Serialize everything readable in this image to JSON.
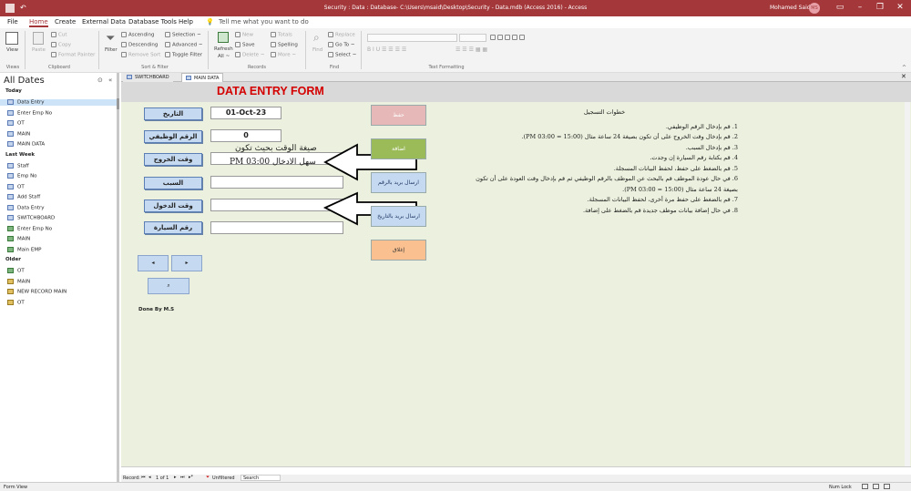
{
  "titlebar": {
    "title": "Security : Data : Database- C:\\Users\\msaid\\Desktop\\Security - Data.mdb (Access 2016) - Access",
    "user": "Mohamed Said",
    "initials": "MS"
  },
  "menu": [
    "File",
    "Home",
    "Create",
    "External Data",
    "Database Tools",
    "Help"
  ],
  "tell_me": "Tell me what you want to do",
  "ribbon": {
    "view": "View",
    "paste": "Paste",
    "cut": "Cut",
    "copy": "Copy",
    "format_painter": "Format Painter",
    "filter": "Filter",
    "ascending": "Ascending",
    "descending": "Descending",
    "remove_sort": "Remove Sort",
    "selection": "Selection ~",
    "advanced": "Advanced ~",
    "toggle_filter": "Toggle Filter",
    "refresh": "Refresh",
    "refresh_all": "All ~",
    "new": "New",
    "save": "Save",
    "delete": "Delete ~",
    "totals": "Totals",
    "spelling": "Spelling",
    "more": "More ~",
    "find": "Find",
    "replace": "Replace",
    "goto": "Go To ~",
    "select": "Select ~",
    "groups": [
      "Views",
      "Clipboard",
      "Sort & Filter",
      "Records",
      "Find",
      "Text Formatting"
    ]
  },
  "nav": {
    "header": "All Dates",
    "sections": [
      {
        "title": "Today",
        "items": [
          {
            "label": "Data Entry",
            "type": "frm",
            "selected": true
          },
          {
            "label": "Enter Emp No",
            "type": "frm"
          },
          {
            "label": "OT",
            "type": "frm"
          },
          {
            "label": "MAIN",
            "type": "frm"
          },
          {
            "label": "MAIN DATA",
            "type": "frm"
          }
        ]
      },
      {
        "title": "Last Week",
        "items": [
          {
            "label": "Staff",
            "type": "frm"
          },
          {
            "label": "Emp No",
            "type": "frm"
          },
          {
            "label": "OT",
            "type": "frm"
          },
          {
            "label": "Add Staff",
            "type": "frm"
          },
          {
            "label": "Data Entry",
            "type": "frm"
          },
          {
            "label": "SWITCHBOARD",
            "type": "frm"
          },
          {
            "label": "Enter Emp No",
            "type": "tbl"
          },
          {
            "label": "MAIN",
            "type": "tbl"
          },
          {
            "label": "Main EMP",
            "type": "tbl"
          }
        ]
      },
      {
        "title": "Older",
        "items": [
          {
            "label": "OT",
            "type": "tbl"
          },
          {
            "label": "MAIN",
            "type": "qry"
          },
          {
            "label": "NEW RECORD MAIN",
            "type": "qry"
          },
          {
            "label": "OT",
            "type": "qry"
          }
        ]
      }
    ]
  },
  "tabs": [
    "SWITCHBOARD",
    "MAIN DATA"
  ],
  "form": {
    "title": "DATA ENTRY FORM",
    "labels": [
      "التاريخ",
      "الرقم الوظيفي",
      "وقت الخروج",
      "السبب",
      "وقت الدخول",
      "رقم السيارة"
    ],
    "values": [
      "01-Oct-23",
      "0",
      "",
      "",
      "",
      ""
    ],
    "annot1": "صيغة الوقت بحيث تكون",
    "annot2": "سهل الادخال PM 03:00",
    "actions": [
      "حفظ",
      "اضافة",
      "ارسال بريد بالرقم",
      "ارسال بريد بالتاريخ",
      "إغلاق"
    ],
    "footer": "Done By M.S",
    "steps_title": "خطوات التسجيل",
    "steps": [
      "1. قم بإدخال الرقم الوظيفي.",
      "2. قم بإدخال وقت الخروج على أن تكون بصيغة 24 ساعة مثال (15:00 = 03:00 PM).",
      "3. قم بإدخال السبب.",
      "4. قم بكتابة رقم السيارة إن وجدت.",
      "5. قم بالضغط على حفظ، لحفظ البيانات المسجلة.",
      "6. في حال عودة الموظف قم بالبحث عن الموظف بالرقم الوظيفي ثم قم بإدخال وقت العودة على أن تكون بصيغة 24 ساعة مثال (15:00 = 03:00 PM).",
      "7. قم بالضغط على حفظ مرة أخرى، لحفظ البيانات المسجلة.",
      "8. في حال إضافة بيانات موظف جديدة قم بالضغط على إضافة."
    ]
  },
  "record": {
    "label": "Record:",
    "pos": "1 of 1",
    "filter": "Unfiltered",
    "search": "Search"
  },
  "status": {
    "left": "Form View",
    "num_lock": "Num Lock"
  }
}
